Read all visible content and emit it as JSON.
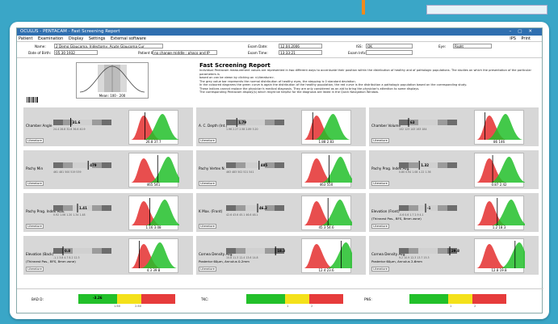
{
  "window": {
    "title": "OCULUS - PENTACAM - Fast Screening Report"
  },
  "menu": [
    "Patient",
    "Examination",
    "Display",
    "Settings",
    "External software"
  ],
  "menu_right": [
    "IPS",
    "Print"
  ],
  "patient": {
    "name_label": "Name:",
    "name_value": "2 Demo Glaucoma, Iridectomy, Acute Glaucoma Cur",
    "dob_label": "Date of Birth:",
    "dob_value": "05 30 1932",
    "patient_id_label": "Patient ID:",
    "patient_id_value": "no change middle : phaco and IP",
    "exam_date_label": "Exam Date:",
    "exam_date_value": "12.04.2006",
    "exam_time_label": "Exam Time:",
    "exam_time_value": "13:33:21",
    "iss_label": "ISS:",
    "iss_value": "OK",
    "eye_label": "Eye:",
    "eye_value": "Right",
    "exam_info_label": "Exam Info:"
  },
  "report": {
    "title": "Fast Screening Report",
    "lines": [
      "Individual Pentacam measurement values are represented in two different ways to accentuate their position within the distribution of healthy and of pathologic populations. The studies on which the presentation of the particular parameters is",
      "based on can be viewn by clicking on <Literature>.",
      "The grey value bar represents the normal distribution of healthy eyes, the stepping is 0 standard deviation.",
      "In the coloured diagrams the green curve is again the distribution of the healthy population, the red curve is the distribution a pathologic population based on the corresponding study.",
      "These indices cannot replace the physician's medical diagnosis. They are only considered as an aid to bring the physician's attention to some displays.",
      "The corresponding Pentacam display(s) which might be helpful for the diagnosis are listed in the Quick Navigation Window."
    ],
    "normal_caption": "Mean: 100 · 200"
  },
  "cells": [
    {
      "name": "Chamber Angle",
      "sub": "",
      "value": "31.6",
      "ticks": "24.4  28.8  32.8  36.6  40.9",
      "marker": 0.26,
      "vals": "26.8  37.7",
      "lit": "Literature"
    },
    {
      "name": "A. C. Depth (Int.)",
      "sub": "",
      "value": "1.79",
      "ticks": "1.96  2.27  2.58  2.89  3.20",
      "marker": 0.12,
      "vals": "1.88  2.83",
      "lit": "Literature"
    },
    {
      "name": "Chamber Volume",
      "sub": "",
      "value": "63",
      "ticks": "102  123  143  163  184",
      "marker": 0.1,
      "vals": "86  146",
      "lit": "Literature"
    },
    {
      "name": "Pachy Min",
      "sub": "",
      "value": "479",
      "ticks": "461  481  500  519  539",
      "marker": 0.62,
      "vals": "465  541",
      "lit": "Literature"
    },
    {
      "name": "Pachy Vertex N.",
      "sub": "",
      "value": "485",
      "ticks": "463  483  502  521  541",
      "marker": 0.58,
      "vals": "463  550",
      "lit": "Literature"
    },
    {
      "name": "Pachy Prog. Index Avg.",
      "sub": "",
      "value": "1.32",
      "ticks": "0.80  0.94  1.08  1.22  1.36",
      "marker": 0.32,
      "vals": "0.87  2.42",
      "lit": "Literature"
    },
    {
      "name": "Pachy Prog. Index Max.",
      "sub": "",
      "value": "1.41",
      "ticks": "0.92  1.06  1.20  1.34  1.48",
      "marker": 0.4,
      "vals": "1.16  3.08",
      "lit": "Literature"
    },
    {
      "name": "K Max. (Front)",
      "sub": "",
      "value": "46.2",
      "ticks": "42.6  43.6  45.1  46.6  48.1",
      "marker": 0.55,
      "vals": "45.3  54.6",
      "lit": "Literature"
    },
    {
      "name": "Elevation (Front)",
      "sub": "(Thinnest Pos., BFS, 8mm zone)",
      "value": "-1",
      "ticks": "-0.6  0.6  1.7  2.9  4.1",
      "marker": 0.45,
      "vals": "1.2  18.3",
      "lit": "Literature"
    },
    {
      "name": "Elevation (Back)",
      "sub": "(Thinnest Pos., BFS, 8mm zone)",
      "value": "0.8",
      "ticks": "-1.1  3.8  4.7  8.2  12.3",
      "marker": 0.1,
      "vals": "4.3  39.8",
      "lit": "Literature"
    },
    {
      "name": "Cornea Density Avg.",
      "sub": "Posterior 60µm, Annulus 0-2mm",
      "value": "18.3",
      "ticks": "10.8  11.3  12.4  13.6  14.8",
      "marker": 0.92,
      "vals": "12.4  23.6",
      "lit": "Literature"
    },
    {
      "name": "Cornea Density Avg.",
      "sub": "Posterior 60µm, Annulus 2-6mm",
      "value": "29.8",
      "ticks": "9.2  10.9  12.3  13.7  15.3",
      "marker": 0.95,
      "vals": "12.8  19.8",
      "lit": "Literature"
    }
  ],
  "bottom": [
    {
      "label": "BAD D:",
      "value": "-3.26",
      "scale": [
        "1.60",
        "2.60"
      ]
    },
    {
      "label": "TKC:",
      "value": "",
      "scale": [
        "1",
        "2"
      ]
    },
    {
      "label": "PNS:",
      "value": "",
      "scale": [
        "1",
        "2"
      ]
    }
  ],
  "colors": {
    "healthy": "#22c02a",
    "pathologic": "#e63b3b",
    "warn": "#f4e11a",
    "titlebar": "#2f6fb0"
  }
}
